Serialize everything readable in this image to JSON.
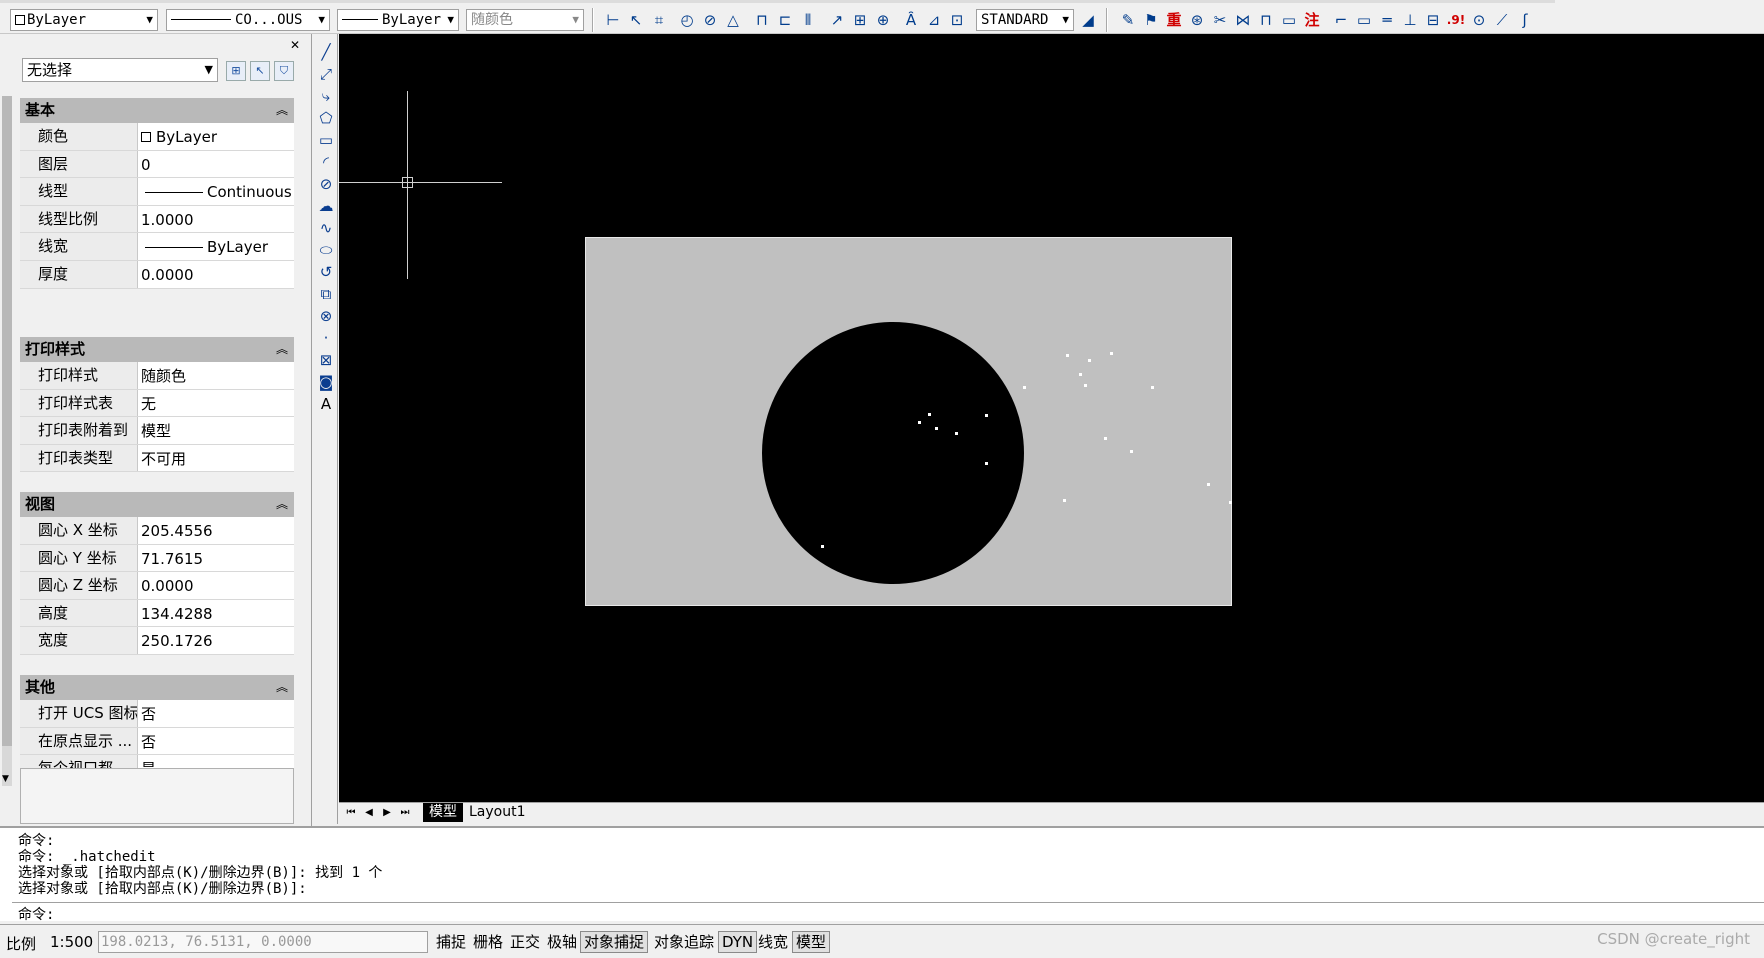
{
  "toolbar": {
    "color_combo": "ByLayer",
    "linetype_combo": "CO...OUS",
    "lineweight_combo": "ByLayer",
    "plotstyle_combo": "随颜色",
    "textstyle_combo": "STANDARD",
    "icon_labels": {
      "red1": "重",
      "red2": "注",
      "red3": ".9!"
    }
  },
  "properties": {
    "selection": "无选择",
    "sections": {
      "basic": {
        "title": "基本",
        "rows": [
          {
            "key": "颜色",
            "value": "ByLayer"
          },
          {
            "key": "图层",
            "value": "0"
          },
          {
            "key": "线型",
            "value": "Continuous"
          },
          {
            "key": "线型比例",
            "value": "1.0000"
          },
          {
            "key": "线宽",
            "value": "ByLayer"
          },
          {
            "key": "厚度",
            "value": "0.0000"
          }
        ]
      },
      "plot": {
        "title": "打印样式",
        "rows": [
          {
            "key": "打印样式",
            "value": "随颜色"
          },
          {
            "key": "打印样式表",
            "value": "无"
          },
          {
            "key": "打印表附着到",
            "value": "模型"
          },
          {
            "key": "打印表类型",
            "value": "不可用"
          }
        ]
      },
      "view": {
        "title": "视图",
        "rows": [
          {
            "key": "圆心 X 坐标",
            "value": "205.4556"
          },
          {
            "key": "圆心 Y 坐标",
            "value": "71.7615"
          },
          {
            "key": "圆心 Z 坐标",
            "value": "0.0000"
          },
          {
            "key": "高度",
            "value": "134.4288"
          },
          {
            "key": "宽度",
            "value": "250.1726"
          }
        ]
      },
      "misc": {
        "title": "其他",
        "rows": [
          {
            "key": "打开 UCS 图标",
            "value": "否"
          },
          {
            "key": "在原点显示 ...",
            "value": "否"
          },
          {
            "key": "每个视口都...",
            "value": "是"
          }
        ]
      }
    }
  },
  "drawbar": {
    "text_tool": "A"
  },
  "tabs": {
    "model": "模型",
    "layout1": "Layout1"
  },
  "command": {
    "lines": [
      "命令:",
      "命令: _.hatchedit",
      "选择对象或 [拾取内部点(K)/删除边界(B)]: 找到 1 个",
      "选择对象或 [拾取内部点(K)/删除边界(B)]:"
    ],
    "prompt": "命令:"
  },
  "status": {
    "scale_label": "比例",
    "scale_value": "1:500",
    "coordinates": "198.0213, 76.5131, 0.0000",
    "buttons": [
      "捕捉",
      "栅格",
      "正交",
      "极轴",
      "对象捕捉",
      "对象追踪",
      "DYN",
      "线宽",
      "模型"
    ]
  },
  "watermark": "CSDN @create_right",
  "colors": {
    "canvas": "#000000",
    "hatch_fill": "#c0c0c0",
    "panel_header": "#b9b9b9"
  }
}
